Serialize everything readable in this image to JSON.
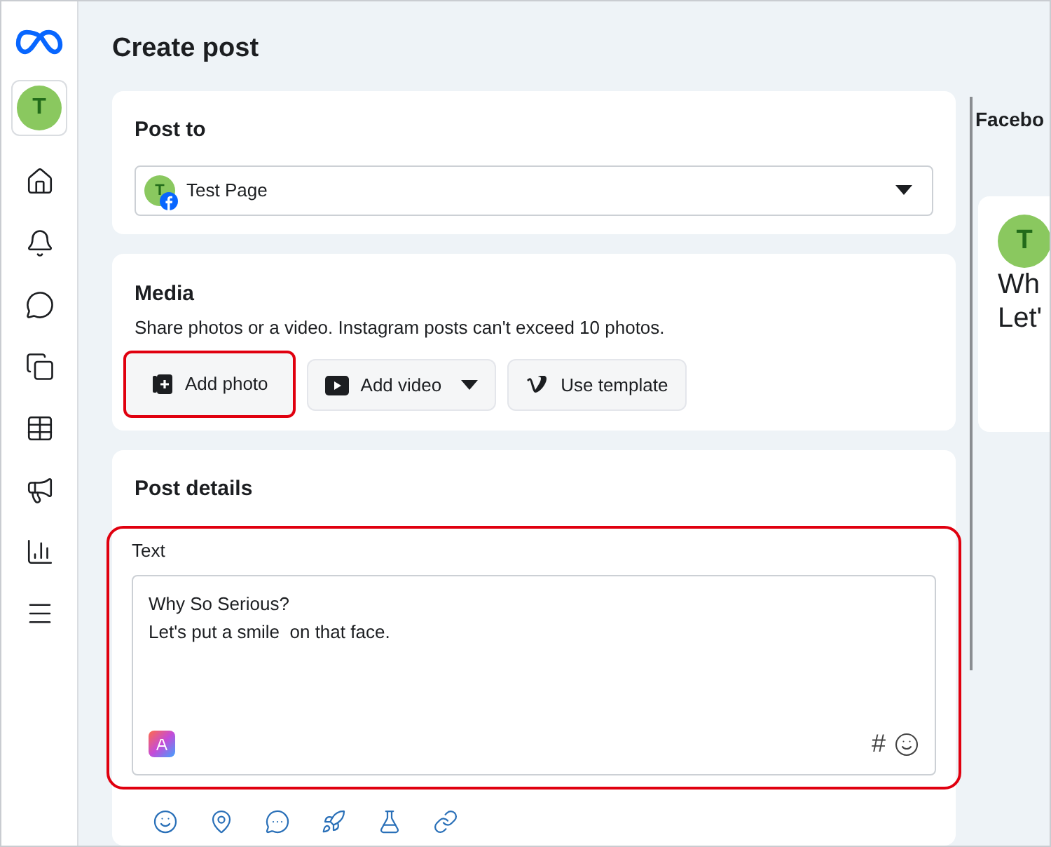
{
  "sidebar": {
    "avatar": "T",
    "items": [
      {
        "kind": "home",
        "selected": false
      },
      {
        "kind": "bell",
        "selected": false
      },
      {
        "kind": "chat",
        "selected": false
      },
      {
        "kind": "pages",
        "selected": false
      },
      {
        "kind": "table",
        "selected": false
      },
      {
        "kind": "megaphone",
        "selected": false
      },
      {
        "kind": "chart",
        "selected": false
      },
      {
        "kind": "menu",
        "selected": false
      }
    ]
  },
  "title": "Create post",
  "post_to": {
    "heading": "Post to",
    "avatar": "T",
    "value": "Test Page"
  },
  "media": {
    "heading": "Media",
    "description": "Share photos or a video. Instagram posts can't exceed 10 photos.",
    "buttons": [
      {
        "kind": "photo",
        "label": "Add photo",
        "highlighted": true
      },
      {
        "kind": "video",
        "label": "Add video",
        "highlighted": false
      },
      {
        "kind": "template",
        "label": "Use template",
        "highlighted": false
      }
    ]
  },
  "post_details": {
    "heading": "Post details",
    "label": "Text",
    "highlighted": true,
    "value": "Why So Serious?\nLet's put a smile  on that face.",
    "hashtag": "#"
  },
  "preview": {
    "heading": "Facebo",
    "avatar": "T",
    "lines": [
      "Wh",
      "Let'"
    ]
  }
}
